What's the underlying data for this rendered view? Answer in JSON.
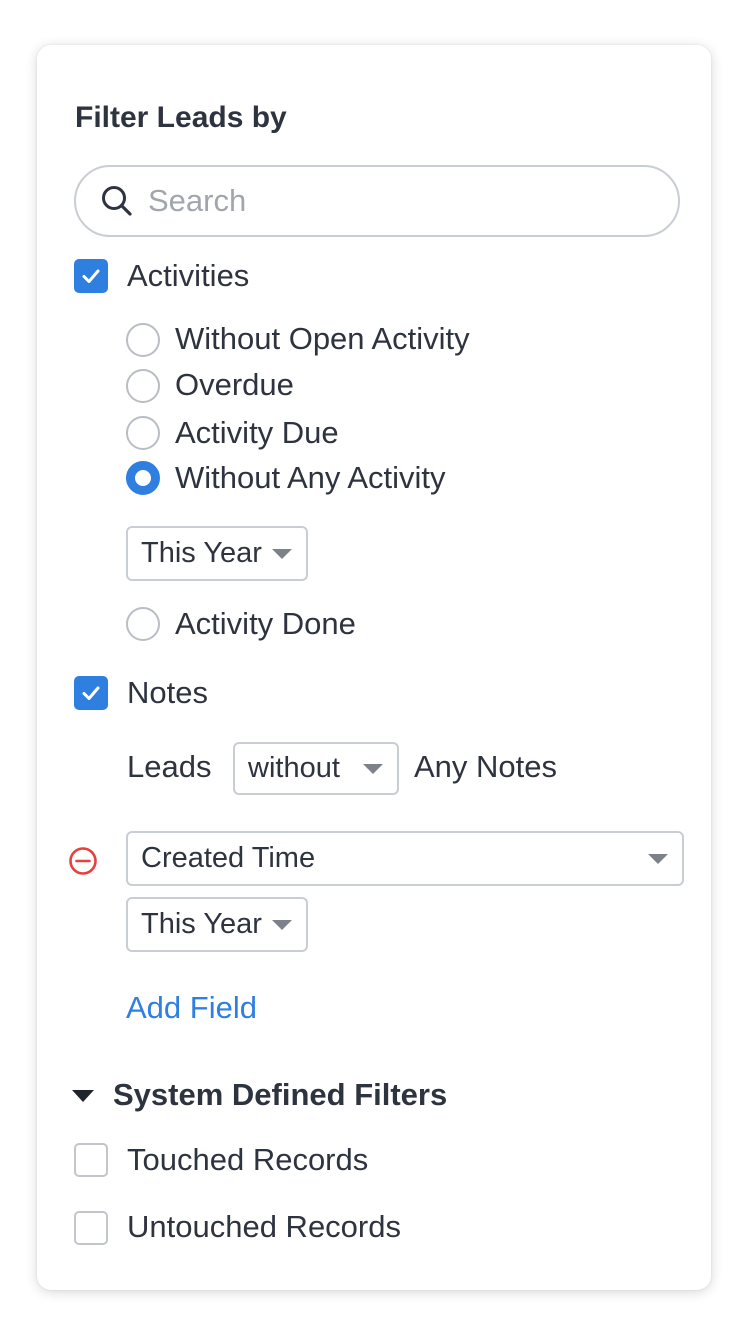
{
  "panel": {
    "title": "Filter Leads by",
    "search": {
      "placeholder": "Search",
      "value": ""
    },
    "activities": {
      "label": "Activities",
      "checked": true,
      "options": [
        {
          "label": "Without Open Activity",
          "selected": false
        },
        {
          "label": "Overdue",
          "selected": false
        },
        {
          "label": "Activity Due",
          "selected": false
        },
        {
          "label": "Without Any Activity",
          "selected": true
        }
      ],
      "period_select": "This Year",
      "activity_done_label": "Activity Done"
    },
    "notes": {
      "label": "Notes",
      "checked": true,
      "prefix": "Leads",
      "condition_select": "without",
      "suffix": "Any Notes"
    },
    "field_filter": {
      "field_select": "Created Time",
      "period_select": "This Year"
    },
    "add_field_label": "Add Field",
    "system_filters": {
      "title": "System Defined Filters",
      "items": [
        {
          "label": "Touched Records",
          "checked": false
        },
        {
          "label": "Untouched Records",
          "checked": false
        }
      ]
    }
  },
  "colors": {
    "accent": "#2f7fe0",
    "remove": "#e5413e",
    "border": "#c9cdd4",
    "text": "#2e3340"
  }
}
